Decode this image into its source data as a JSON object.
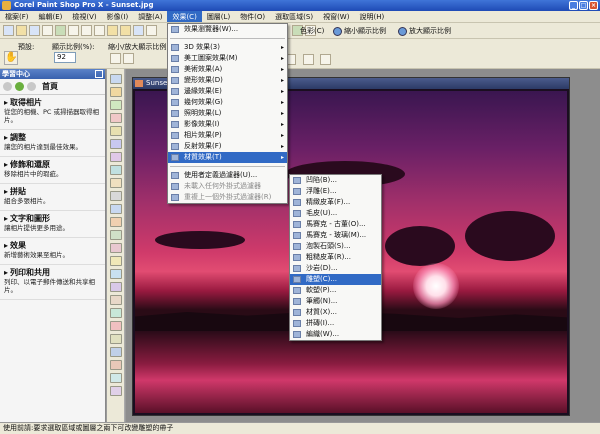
{
  "app": {
    "title": "Corel Paint Shop Pro X - Sunset.jpg",
    "buttons": [
      "_",
      "□",
      "×"
    ]
  },
  "menubar": {
    "items": [
      "檔案(F)",
      "編輯(E)",
      "檢視(V)",
      "影像(I)",
      "調整(A)",
      "效果(C)",
      "圖層(L)",
      "物件(O)",
      "選取區域(S)",
      "視窗(W)",
      "說明(H)"
    ],
    "active_index": 5
  },
  "toolbar": {
    "color_label": "色彩(C)",
    "zoom_out_label": "縮小顯示比例",
    "zoom_in_label": "放大顯示比例"
  },
  "tool_options": {
    "preset_label": "預設:",
    "zoom_label": "顯示比例(%):",
    "zoom_value": "92",
    "zoom_mode_label": "縮小/放大顯示比例",
    "hand_icon": "hand-icon"
  },
  "learning_center": {
    "header": "學習中心",
    "home_label": "首頁",
    "sections": [
      {
        "title": "取得相片",
        "desc": "從您的相機、PC 或掃描器取得相片。"
      },
      {
        "title": "調整",
        "desc": "讓您的相片達到最佳效果。"
      },
      {
        "title": "修飾和還原",
        "desc": "移除相片中的瑕疵。"
      },
      {
        "title": "拼貼",
        "desc": "組合多張相片。"
      },
      {
        "title": "文字和圖形",
        "desc": "讓相片提供更多用途。"
      },
      {
        "title": "效果",
        "desc": "新增藝術效果至相片。"
      },
      {
        "title": "列印和共用",
        "desc": "列印、以電子郵件傳送和共享相片。"
      }
    ]
  },
  "image_window": {
    "title": "Sunset.jpg"
  },
  "effects_menu": {
    "items": [
      {
        "label": "效果瀏覽器(W)...",
        "sub": false
      },
      {
        "sep": true
      },
      {
        "label": "3D 效果(3)",
        "sub": true
      },
      {
        "label": "美工圖案效果(M)",
        "sub": true
      },
      {
        "label": "美術效果(A)",
        "sub": true
      },
      {
        "label": "變形效果(D)",
        "sub": true
      },
      {
        "label": "邊緣效果(E)",
        "sub": true
      },
      {
        "label": "幾何效果(G)",
        "sub": true
      },
      {
        "label": "照明效果(L)",
        "sub": true
      },
      {
        "label": "影像效果(I)",
        "sub": true
      },
      {
        "label": "相片效果(P)",
        "sub": true
      },
      {
        "label": "反射效果(F)",
        "sub": true
      },
      {
        "label": "材質效果(T)",
        "sub": true,
        "highlight": true
      },
      {
        "sep": true
      },
      {
        "label": "使用者定義過濾器(U)...",
        "sub": false
      },
      {
        "label": "未載入任何外掛式過濾器",
        "sub": false,
        "disabled": true
      },
      {
        "label": "重複上一個外掛式過濾器(R)",
        "sub": false,
        "disabled": true
      }
    ]
  },
  "artistic_submenu": {
    "items": [
      {
        "label": "凹陷(B)..."
      },
      {
        "label": "浮雕(E)..."
      },
      {
        "label": "精緻皮革(F)..."
      },
      {
        "label": "毛皮(U)..."
      },
      {
        "label": "馬賽克 - 古董(O)..."
      },
      {
        "label": "馬賽克 - 玻璃(M)..."
      },
      {
        "label": "泡製石頭(S)..."
      },
      {
        "label": "粗糙皮革(R)..."
      },
      {
        "label": "沙岩(D)..."
      },
      {
        "label": "雕塑(C)...",
        "highlight": true
      },
      {
        "label": "軟塑(P)..."
      },
      {
        "label": "筆觸(N)..."
      },
      {
        "label": "材質(X)..."
      },
      {
        "label": "拼磚(I)..."
      },
      {
        "label": "編織(W)..."
      }
    ]
  },
  "status_text": "使用前請:要求選取區域或圖層之兩下可改變雕塑的帶子"
}
